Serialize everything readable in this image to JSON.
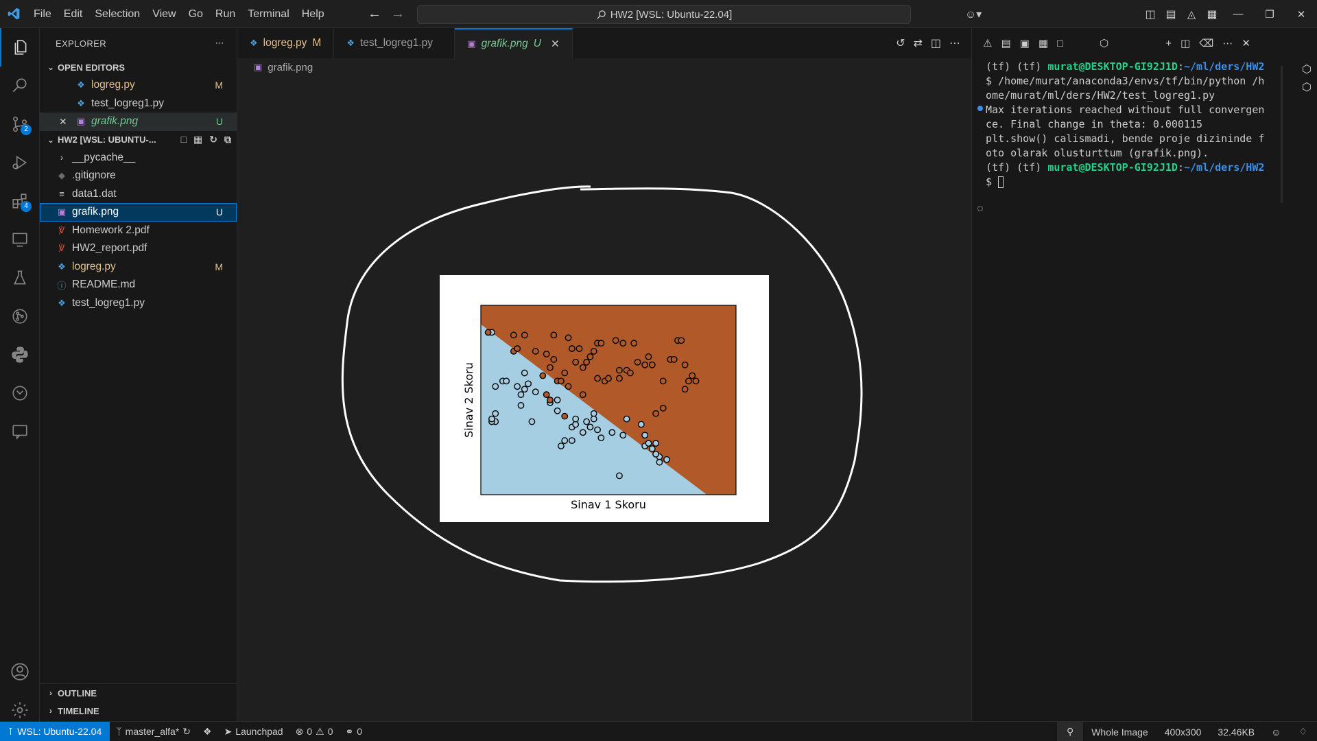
{
  "menu": [
    "File",
    "Edit",
    "Selection",
    "View",
    "Go",
    "Run",
    "Terminal",
    "Help"
  ],
  "search": {
    "label": "HW2 [WSL: Ubuntu-22.04]"
  },
  "sidebar": {
    "title": "EXPLORER",
    "open_editors_label": "OPEN EDITORS",
    "open_editors": [
      {
        "name": "logreg.py",
        "status": "M"
      },
      {
        "name": "test_logreg1.py",
        "status": ""
      },
      {
        "name": "grafik.png",
        "status": "U"
      }
    ],
    "workspace_label": "HW2 [WSL: UBUNTU-...",
    "files": [
      {
        "name": "__pycache__",
        "status": ""
      },
      {
        "name": ".gitignore",
        "status": ""
      },
      {
        "name": "data1.dat",
        "status": ""
      },
      {
        "name": "grafik.png",
        "status": "U"
      },
      {
        "name": "Homework 2.pdf",
        "status": ""
      },
      {
        "name": "HW2_report.pdf",
        "status": ""
      },
      {
        "name": "logreg.py",
        "status": "M"
      },
      {
        "name": "README.md",
        "status": ""
      },
      {
        "name": "test_logreg1.py",
        "status": ""
      }
    ],
    "outline_label": "OUTLINE",
    "timeline_label": "TIMELINE"
  },
  "tabs": [
    {
      "label": "logreg.py",
      "status": "M"
    },
    {
      "label": "test_logreg1.py",
      "status": ""
    },
    {
      "label": "grafik.png",
      "status": "U"
    }
  ],
  "breadcrumb": "grafik.png",
  "terminal": {
    "lines": [
      {
        "a": "(tf) (tf) ",
        "user": "murat@DESKTOP-GI92J1D",
        "c": ":",
        "path": "~/ml/ders/HW2"
      },
      {
        "text": "$ /home/murat/anaconda3/envs/tf/bin/python /h"
      },
      {
        "text": "ome/murat/ml/ders/HW2/test_logreg1.py"
      },
      {
        "text": "Max iterations reached without full convergen"
      },
      {
        "text": "ce. Final change in theta: 0.000115"
      },
      {
        "text": "plt.show() calismadi, bende proje dizininde f"
      },
      {
        "text": "oto olarak olusturttum (grafik.png)."
      },
      {
        "a": "(tf) (tf) ",
        "user": "murat@DESKTOP-GI92J1D",
        "c": ":",
        "path": "~/ml/ders/HW2"
      },
      {
        "text": "$ "
      }
    ]
  },
  "status": {
    "remote": "WSL: Ubuntu-22.04",
    "branch": "master_alfa*",
    "launchpad": "Launchpad",
    "errors": "0",
    "warnings": "0",
    "ports": "0",
    "zoom_label": "Whole Image",
    "dimensions": "400x300",
    "filesize": "32.46KB"
  },
  "chart_data": {
    "type": "scatter",
    "xlabel": "Sinav 1 Skoru",
    "ylabel": "Sinav 2 Skoru",
    "xlim": [
      30,
      100
    ],
    "ylim": [
      30,
      100
    ],
    "decision_boundary": {
      "x": [
        30,
        92
      ],
      "y": [
        93,
        30
      ]
    },
    "colors": {
      "class0_region": "#a6cee3",
      "class1_region": "#b15928",
      "class0_point": "#a6cee3",
      "class1_point": "#b15928",
      "edge": "#000000"
    },
    "series": [
      {
        "values_x": [
          33,
          34,
          34,
          33,
          33,
          34,
          36,
          37,
          40,
          41,
          41,
          42,
          42,
          43,
          44,
          45,
          49,
          51,
          51,
          52,
          53,
          55,
          55,
          56,
          56,
          58,
          59,
          60,
          61,
          61,
          62,
          63,
          66,
          68,
          69,
          70,
          74,
          75,
          75,
          76,
          77,
          78,
          79,
          81,
          79,
          78
        ],
        "values_y": [
          90,
          60,
          57,
          57,
          58,
          70,
          72,
          72,
          70,
          67,
          63,
          69,
          75,
          71,
          57,
          68,
          64,
          65,
          61,
          48,
          50,
          55,
          50,
          56,
          58,
          53,
          57,
          55,
          60,
          58,
          54,
          51,
          53,
          37,
          52,
          58,
          56,
          48,
          52,
          49,
          47,
          49,
          44,
          43,
          42,
          45
        ],
        "class": 0
      },
      {
        "values_x": [
          32,
          39,
          39,
          40,
          42,
          45,
          48,
          47,
          48,
          49,
          49,
          50,
          50,
          51,
          52,
          53,
          53,
          54,
          54,
          55,
          56,
          57,
          58,
          58,
          59,
          60,
          61,
          62,
          62,
          63,
          64,
          65,
          67,
          68,
          68,
          69,
          70,
          71,
          72,
          73,
          75,
          76,
          77,
          78,
          80,
          80,
          82,
          83,
          84,
          85,
          86,
          86,
          87,
          88,
          89
        ],
        "values_y": [
          90,
          89,
          83,
          84,
          89,
          83,
          82,
          74,
          67,
          65,
          77,
          89,
          80,
          72,
          72,
          75,
          59,
          70,
          88,
          84,
          79,
          84,
          67,
          77,
          79,
          81,
          83,
          86,
          73,
          86,
          72,
          73,
          87,
          76,
          73,
          86,
          76,
          75,
          86,
          79,
          78,
          81,
          78,
          60,
          62,
          72,
          80,
          80,
          87,
          87,
          78,
          69,
          72,
          74,
          72
        ],
        "class": 1
      }
    ]
  }
}
